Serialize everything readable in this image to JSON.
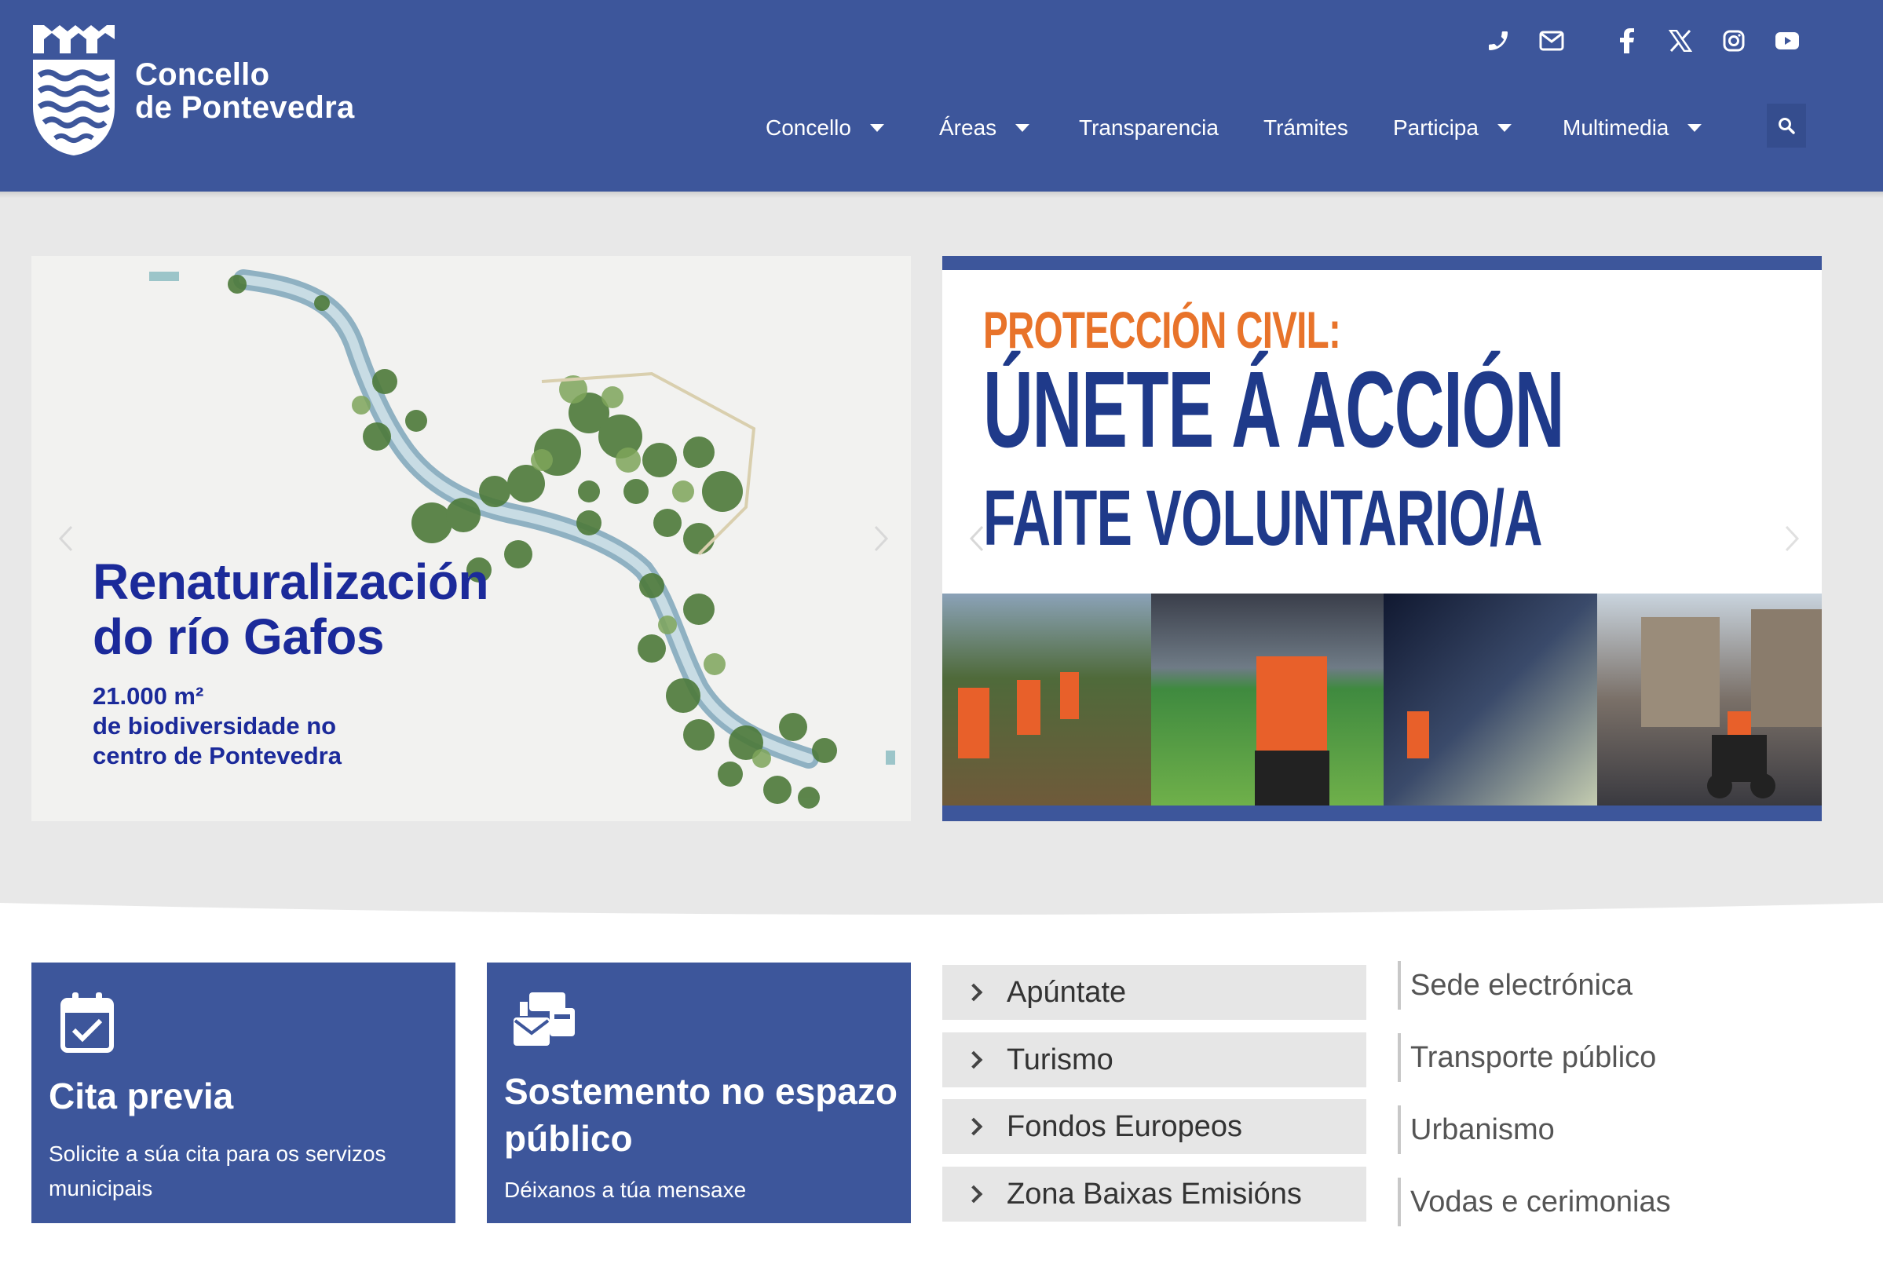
{
  "header": {
    "brand_line1": "Concello",
    "brand_line2": "de Pontevedra",
    "top_icons": [
      "phone-icon",
      "mail-icon",
      "facebook-icon",
      "x-twitter-icon",
      "instagram-icon",
      "youtube-icon"
    ],
    "nav": [
      {
        "label": "Concello",
        "dropdown": true
      },
      {
        "label": "Áreas",
        "dropdown": true
      },
      {
        "label": "Transparencia",
        "dropdown": false
      },
      {
        "label": "Trámites",
        "dropdown": false
      },
      {
        "label": "Participa",
        "dropdown": true
      },
      {
        "label": "Multimedia",
        "dropdown": true
      }
    ],
    "search_icon": "search-icon"
  },
  "slides": {
    "slide1": {
      "title_line1": "Renaturalización",
      "title_line2": "do río Gafos",
      "sub_line1": "21.000 m²",
      "sub_line2": "de biodiversidade no",
      "sub_line3": "centro de Pontevedra"
    },
    "slide2": {
      "line1": "PROTECCIÓN CIVIL:",
      "line2": "ÚNETE Á ACCIÓN",
      "line3": "FAITE  VOLUNTARIO/A"
    }
  },
  "cards": {
    "cita": {
      "title": "Cita previa",
      "desc": "Solicite a súa cita para os servizos municipais",
      "icon": "calendar-check-icon"
    },
    "sostemento": {
      "title": "Sostemento no espazo público",
      "desc": "Déixanos a túa mensaxe",
      "icon": "mail-bulk-icon"
    }
  },
  "accordion": [
    "Apúntate",
    "Turismo",
    "Fondos Europeos",
    "Zona Baixas Emisións"
  ],
  "quick_links": [
    "Sede electrónica",
    "Transporte público",
    "Urbanismo",
    "Vodas e cerimonias"
  ],
  "colors": {
    "header": "#3d569b",
    "hero_bg": "#e8e8e8",
    "slide_title": "#1b2a9a",
    "orange": "#e8732a"
  }
}
